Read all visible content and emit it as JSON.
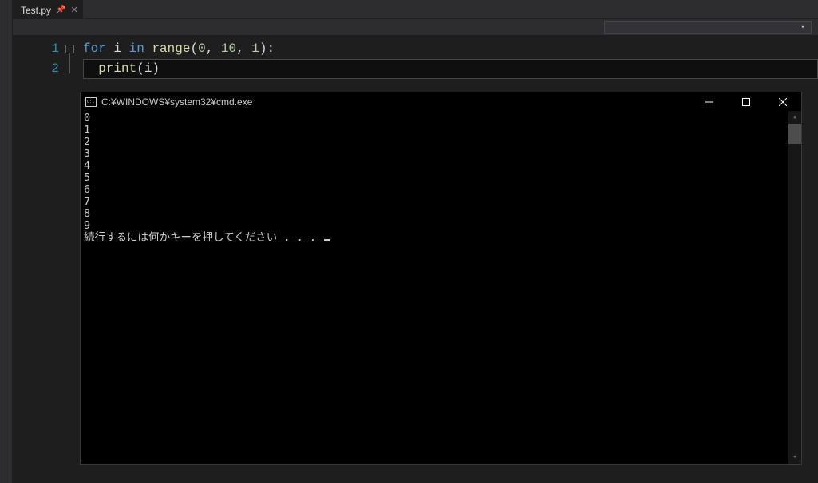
{
  "tabs": [
    {
      "label": "Test.py",
      "pinned": true
    }
  ],
  "editor": {
    "lines": [
      {
        "num": "1",
        "tokens": [
          {
            "cls": "kw",
            "t": "for"
          },
          {
            "cls": "",
            "t": " i "
          },
          {
            "cls": "kw",
            "t": "in"
          },
          {
            "cls": "",
            "t": " "
          },
          {
            "cls": "fn",
            "t": "range"
          },
          {
            "cls": "",
            "t": "("
          },
          {
            "cls": "num",
            "t": "0"
          },
          {
            "cls": "",
            "t": ", "
          },
          {
            "cls": "num",
            "t": "10"
          },
          {
            "cls": "",
            "t": ", "
          },
          {
            "cls": "num",
            "t": "1"
          },
          {
            "cls": "",
            "t": "):"
          }
        ],
        "current": false
      },
      {
        "num": "2",
        "tokens": [
          {
            "cls": "",
            "t": "  "
          },
          {
            "cls": "fn",
            "t": "print"
          },
          {
            "cls": "",
            "t": "(i)"
          }
        ],
        "current": true
      }
    ]
  },
  "console": {
    "title": "C:¥WINDOWS¥system32¥cmd.exe",
    "output_lines": [
      "0",
      "1",
      "2",
      "3",
      "4",
      "5",
      "6",
      "7",
      "8",
      "9"
    ],
    "prompt": "続行するには何かキーを押してください . . . "
  }
}
